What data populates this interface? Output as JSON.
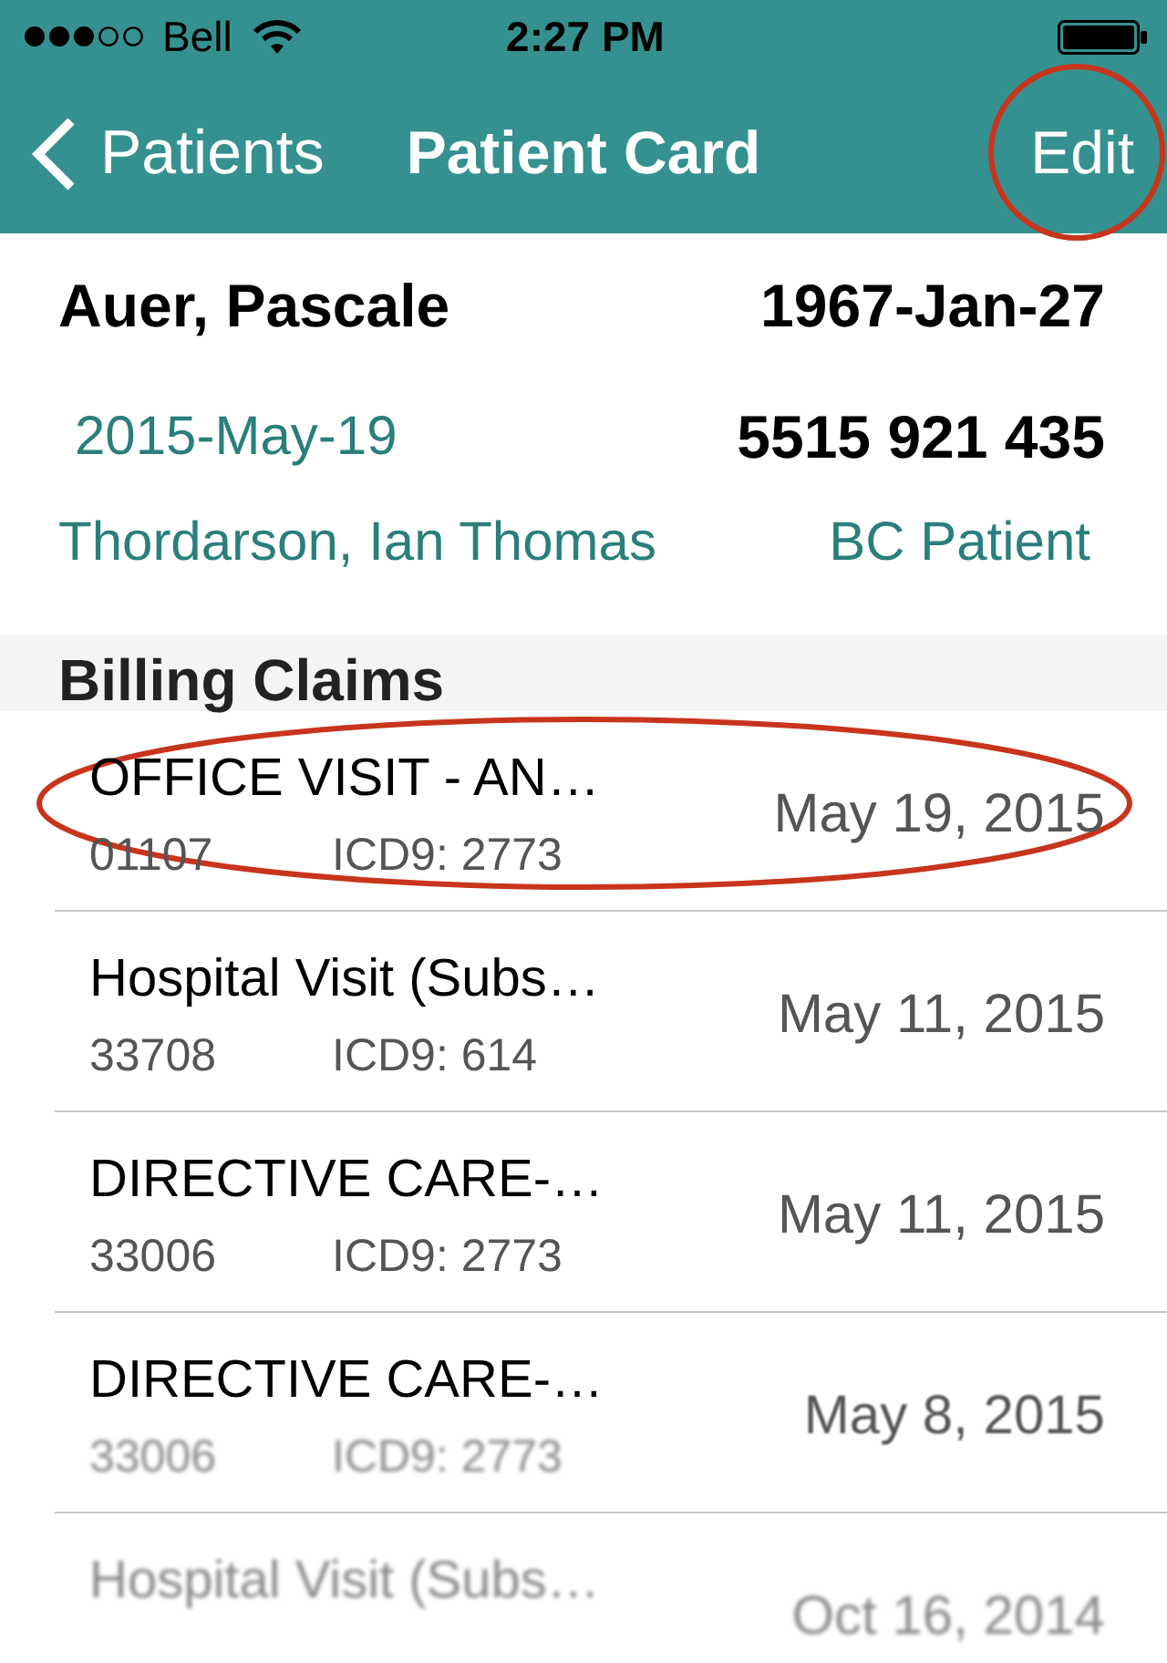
{
  "status_bar": {
    "carrier": "Bell",
    "time": "2:27 PM"
  },
  "nav_bar": {
    "back_label": "Patients",
    "title": "Patient Card",
    "action": {
      "label": "Edit",
      "highlighted": true
    }
  },
  "patient": {
    "name": "Auer, Pascale",
    "birth_date": "1967-Jan-27",
    "visit_date": "2015-May-19",
    "health_number": "5515 921 435",
    "physician": "Thordarson, Ian Thomas",
    "patient_type": "BC Patient"
  },
  "billing_claims": {
    "title": "Billing Claims",
    "items": [
      {
        "description": "OFFICE VISIT - AN…",
        "fee_code": "01107",
        "diagnosis": "ICD9: 2773",
        "date": "May 19, 2015",
        "highlighted": true,
        "title_blurred": false,
        "details_blurred": false
      },
      {
        "description": "Hospital Visit (Subs…",
        "fee_code": "33708",
        "diagnosis": "ICD9: 614",
        "date": "May 11, 2015",
        "highlighted": false,
        "title_blurred": false,
        "details_blurred": false
      },
      {
        "description": "DIRECTIVE CARE-…",
        "fee_code": "33006",
        "diagnosis": "ICD9: 2773",
        "date": "May 11, 2015",
        "highlighted": false,
        "title_blurred": false,
        "details_blurred": false
      },
      {
        "description": "DIRECTIVE CARE-…",
        "fee_code": "33006",
        "diagnosis": "ICD9: 2773",
        "date": "May 8, 2015",
        "highlighted": false,
        "title_blurred": false,
        "details_blurred": true
      },
      {
        "description": "Hospital Visit (Subs…",
        "date": "Oct 16, 2014",
        "highlighted": false,
        "title_blurred": true,
        "details_blurred": true
      }
    ]
  }
}
